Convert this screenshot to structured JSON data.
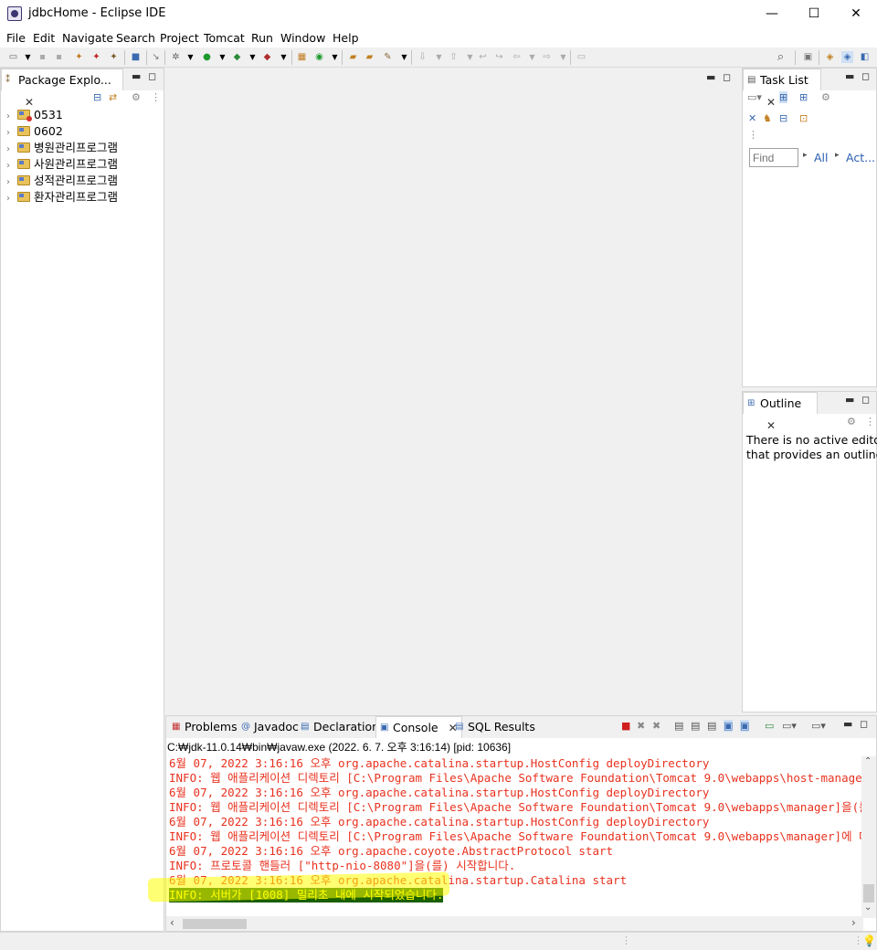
{
  "window": {
    "title": "jdbcHome - Eclipse IDE",
    "controls": {
      "minimize": "—",
      "maximize": "☐",
      "close": "✕"
    }
  },
  "menu": [
    "File",
    "Edit",
    "Navigate",
    "Search",
    "Project",
    "Tomcat",
    "Run",
    "Window",
    "Help"
  ],
  "package_explorer": {
    "tab_label": "Package Explo...",
    "projects": [
      {
        "name": "0531",
        "error": true
      },
      {
        "name": "0602",
        "error": false
      },
      {
        "name": "병원관리프로그램",
        "error": false
      },
      {
        "name": "사원관리프로그램",
        "error": false
      },
      {
        "name": "성적관리프로그램",
        "error": false
      },
      {
        "name": "환자관리프로그램",
        "error": false
      }
    ]
  },
  "task_list": {
    "tab_label": "Task List",
    "find_placeholder": "Find",
    "all_label": "All",
    "act_label": "Act..."
  },
  "outline": {
    "tab_label": "Outline",
    "message_line1": "There is no active editor",
    "message_line2": "that provides an outline."
  },
  "bottom_tabs": {
    "problems": "Problems",
    "javadoc": "Javadoc",
    "declaration": "Declaration",
    "console": "Console",
    "sql_results": "SQL Results"
  },
  "console": {
    "process_label": "C:₩jdk-11.0.14₩bin₩javaw.exe  (2022. 6. 7. 오후 3:16:14) [pid: 10636]",
    "lines": [
      "6월 07, 2022 3:16:16 오후 org.apache.catalina.startup.HostConfig deployDirectory",
      "INFO: 웹 애플리케이션 디렉토리 [C:\\Program Files\\Apache Software Foundation\\Tomcat 9.0\\webapps\\host-manager]에 대한",
      "6월 07, 2022 3:16:16 오후 org.apache.catalina.startup.HostConfig deployDirectory",
      "INFO: 웹 애플리케이션 디렉토리 [C:\\Program Files\\Apache Software Foundation\\Tomcat 9.0\\webapps\\manager]을(를) 배치합",
      "6월 07, 2022 3:16:16 오후 org.apache.catalina.startup.HostConfig deployDirectory",
      "INFO: 웹 애플리케이션 디렉토리 [C:\\Program Files\\Apache Software Foundation\\Tomcat 9.0\\webapps\\manager]에 대한 배치가",
      "6월 07, 2022 3:16:16 오후 org.apache.coyote.AbstractProtocol start",
      "INFO: 프로토콜 핸들러 [\"http-nio-8080\"]을(를) 시작합니다.",
      "6월 07, 2022 3:16:16 오후 org.apache.catalina.startup.Catalina start"
    ],
    "highlighted_line": "INFO: 서버가 [1008] 밀리초 내에 시작되었습니다."
  },
  "colors": {
    "console_text": "#e8321f",
    "highlight_bg": "#1a5f00",
    "highlight_text": "#ffff00",
    "marker": "#ffff00"
  }
}
